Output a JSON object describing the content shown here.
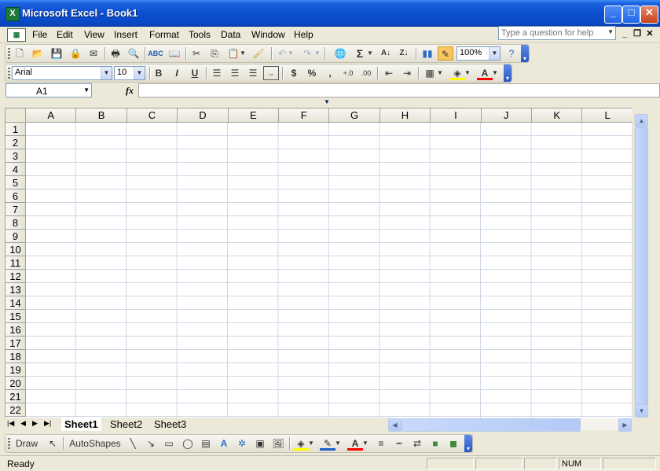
{
  "window": {
    "title": "Microsoft Excel - Book1",
    "app_icon_glyph": "X"
  },
  "menu": {
    "items": [
      "File",
      "Edit",
      "View",
      "Insert",
      "Format",
      "Tools",
      "Data",
      "Window",
      "Help"
    ],
    "help_placeholder": "Type a question for help"
  },
  "standard_toolbar": {
    "zoom": "100%"
  },
  "formatting_toolbar": {
    "font": "Arial",
    "font_size": "10"
  },
  "formula_bar": {
    "name_box": "A1",
    "fx_label": "fx",
    "formula": ""
  },
  "grid": {
    "columns": [
      "A",
      "B",
      "C",
      "D",
      "E",
      "F",
      "G",
      "H",
      "I",
      "J",
      "K",
      "L"
    ],
    "rows": [
      "1",
      "2",
      "3",
      "4",
      "5",
      "6",
      "7",
      "8",
      "9",
      "10",
      "11",
      "12",
      "13",
      "14",
      "15",
      "16",
      "17",
      "18",
      "19",
      "20",
      "21",
      "22"
    ]
  },
  "sheets": {
    "tabs": [
      "Sheet1",
      "Sheet2",
      "Sheet3"
    ],
    "active": "Sheet1"
  },
  "drawing_toolbar": {
    "draw_label": "Draw",
    "autoshapes_label": "AutoShapes"
  },
  "status_bar": {
    "status": "Ready",
    "num_indicator": "NUM"
  },
  "colors": {
    "title_bar": "#0b4ecf",
    "chrome": "#ece9d8",
    "gridline": "#d0d7e5",
    "fill_highlight": "#ffff00",
    "font_color": "#ff0000"
  }
}
